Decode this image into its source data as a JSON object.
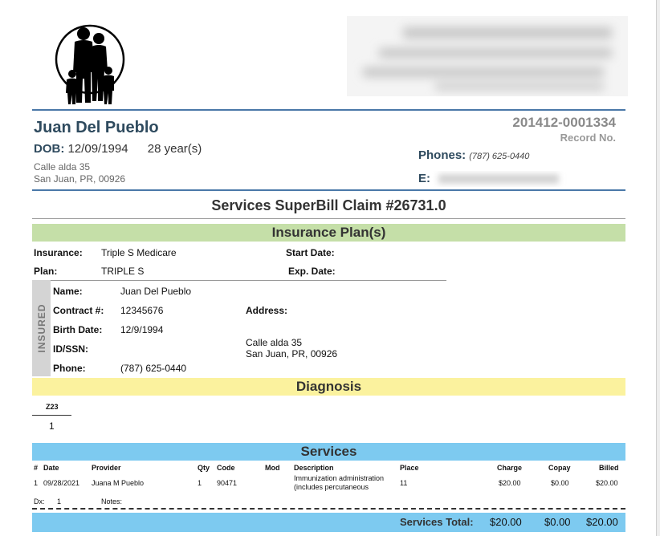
{
  "patient": {
    "name": "Juan Del Pueblo",
    "dob_label": "DOB:",
    "dob": "12/09/1994",
    "age": "28 year(s)",
    "address_line1": "Calle alda 35",
    "address_line2": "San Juan, PR, 00926",
    "phones_label": "Phones:",
    "phone": "(787) 625-0440",
    "email_label": "E:"
  },
  "record": {
    "number": "201412-0001334",
    "label": "Record No."
  },
  "claim_title": "Services SuperBill Claim #26731.0",
  "insurance": {
    "section_title": "Insurance Plan(s)",
    "insurance_label": "Insurance:",
    "insurance_value": "Triple S Medicare",
    "plan_label": "Plan:",
    "plan_value": "TRIPLE S",
    "start_date_label": "Start Date:",
    "exp_date_label": "Exp. Date:",
    "insured_tab": "INSURED",
    "name_label": "Name:",
    "name_value": "Juan Del Pueblo",
    "contract_label": "Contract #:",
    "contract_value": "12345676",
    "birth_label": "Birth Date:",
    "birth_value": "12/9/1994",
    "idssn_label": "ID/SSN:",
    "phone_label": "Phone:",
    "phone_value": "(787) 625-0440",
    "address_label": "Address:",
    "address_line1": "Calle alda 35",
    "address_line2": "San Juan, PR, 00926"
  },
  "diagnosis": {
    "section_title": "Diagnosis",
    "code_header": "Z23",
    "code_value": "1"
  },
  "services": {
    "section_title": "Services",
    "headers": {
      "num": "#",
      "date": "Date",
      "provider": "Provider",
      "qty": "Qty",
      "code": "Code",
      "mod": "Mod",
      "description": "Description",
      "place": "Place",
      "charge": "Charge",
      "copay": "Copay",
      "billed": "Billed"
    },
    "rows": [
      {
        "num": "1",
        "date": "09/28/2021",
        "provider": "Juana M Pueblo",
        "qty": "1",
        "code": "90471",
        "mod": "",
        "description_line1": "Immunization administration",
        "description_line2": "(includes percutaneous",
        "place": "11",
        "charge": "$20.00",
        "copay": "$0.00",
        "billed": "$20.00",
        "dx_label": "Dx:",
        "dx_value": "1",
        "notes_label": "Notes:"
      }
    ],
    "total_label": "Services Total:",
    "total_charge": "$20.00",
    "total_copay": "$0.00",
    "total_billed": "$20.00"
  },
  "colors": {
    "header_rule": "#4a78a8",
    "insurance_band": "#c5dfa8",
    "diagnosis_band": "#fbf29e",
    "services_band": "#7dcaf0",
    "name_text": "#2e4a5e"
  },
  "icons": {
    "logo": "family-silhouette-logo",
    "blurred_header": "redacted-clinic-info",
    "blurred_email": "redacted-email"
  }
}
